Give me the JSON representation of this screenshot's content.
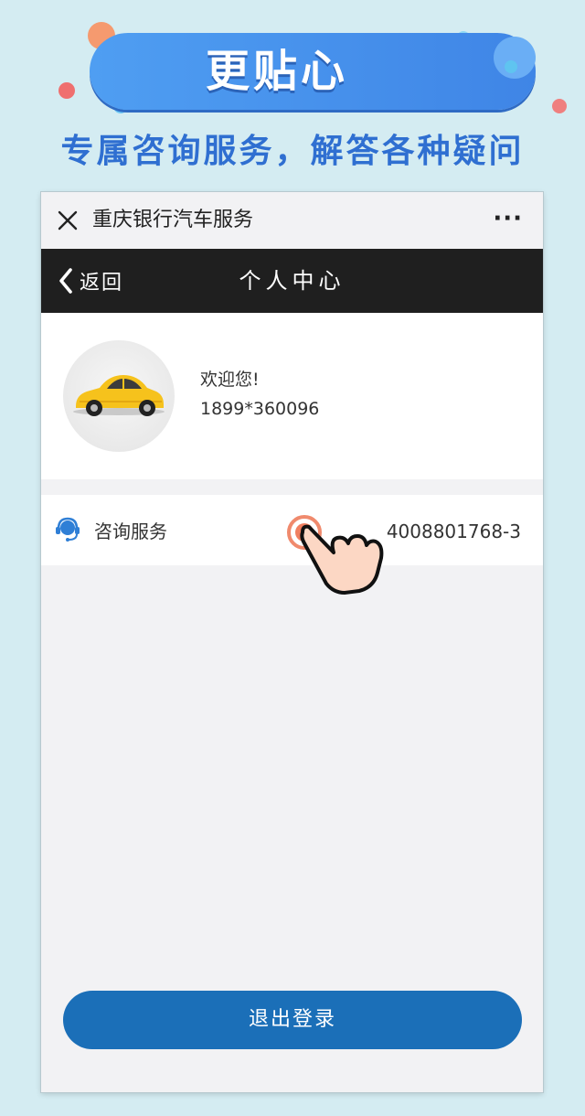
{
  "banner": {
    "title": "更贴心",
    "subtitle": "专属咨询服务，解答各种疑问"
  },
  "wechat_bar": {
    "title": "重庆银行汽车服务",
    "close_icon": "close-icon",
    "more_label": "···"
  },
  "navbar": {
    "back_label": "返回",
    "title": "个人中心",
    "back_icon": "chevron-left-icon"
  },
  "profile": {
    "welcome": "欢迎您!",
    "phone": "1899*360096",
    "avatar_icon": "car-icon"
  },
  "service": {
    "label": "咨询服务",
    "phone": "4008801768-3",
    "icon": "headset-icon"
  },
  "logout": {
    "label": "退出登录"
  },
  "colors": {
    "page_bg": "#d4ecf2",
    "banner_blue": "#4f9ef2",
    "subtitle_blue": "#2f6fd1",
    "navbar_bg": "#1f1f1f",
    "logout_bg": "#1b6fb8",
    "car_yellow": "#f6c21c"
  }
}
